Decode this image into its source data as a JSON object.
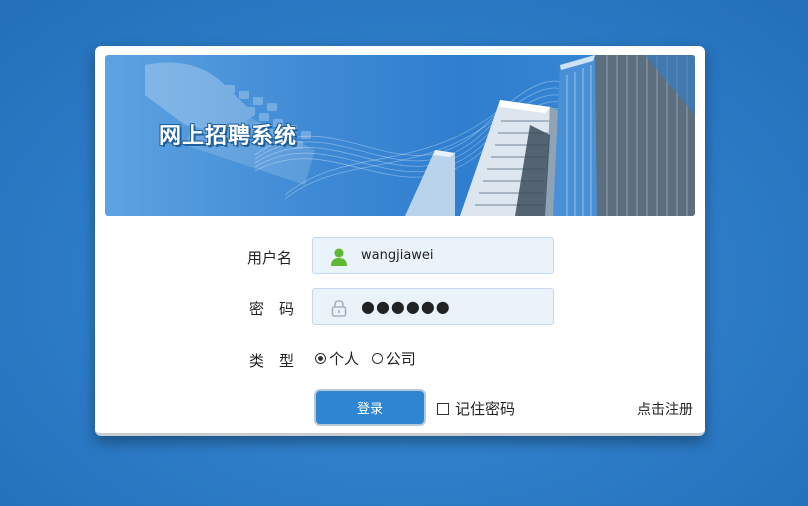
{
  "banner": {
    "title": "网上招聘系统"
  },
  "form": {
    "username": {
      "label": "用户名",
      "value": "wangjiawei",
      "icon": "user-icon"
    },
    "password": {
      "label": "密　码",
      "value": "●●●●●●",
      "icon": "lock-icon"
    },
    "type": {
      "label": "类　型",
      "options": [
        {
          "label": "个人",
          "selected": true
        },
        {
          "label": "公司",
          "selected": false
        }
      ]
    },
    "login_label": "登录",
    "remember_label": "记住密码",
    "register_label": "点击注册"
  },
  "colors": {
    "background": "#2f7fca",
    "button": "#2e86d2",
    "field_bg": "#eaf2fa",
    "user_icon": "#5fb832"
  }
}
